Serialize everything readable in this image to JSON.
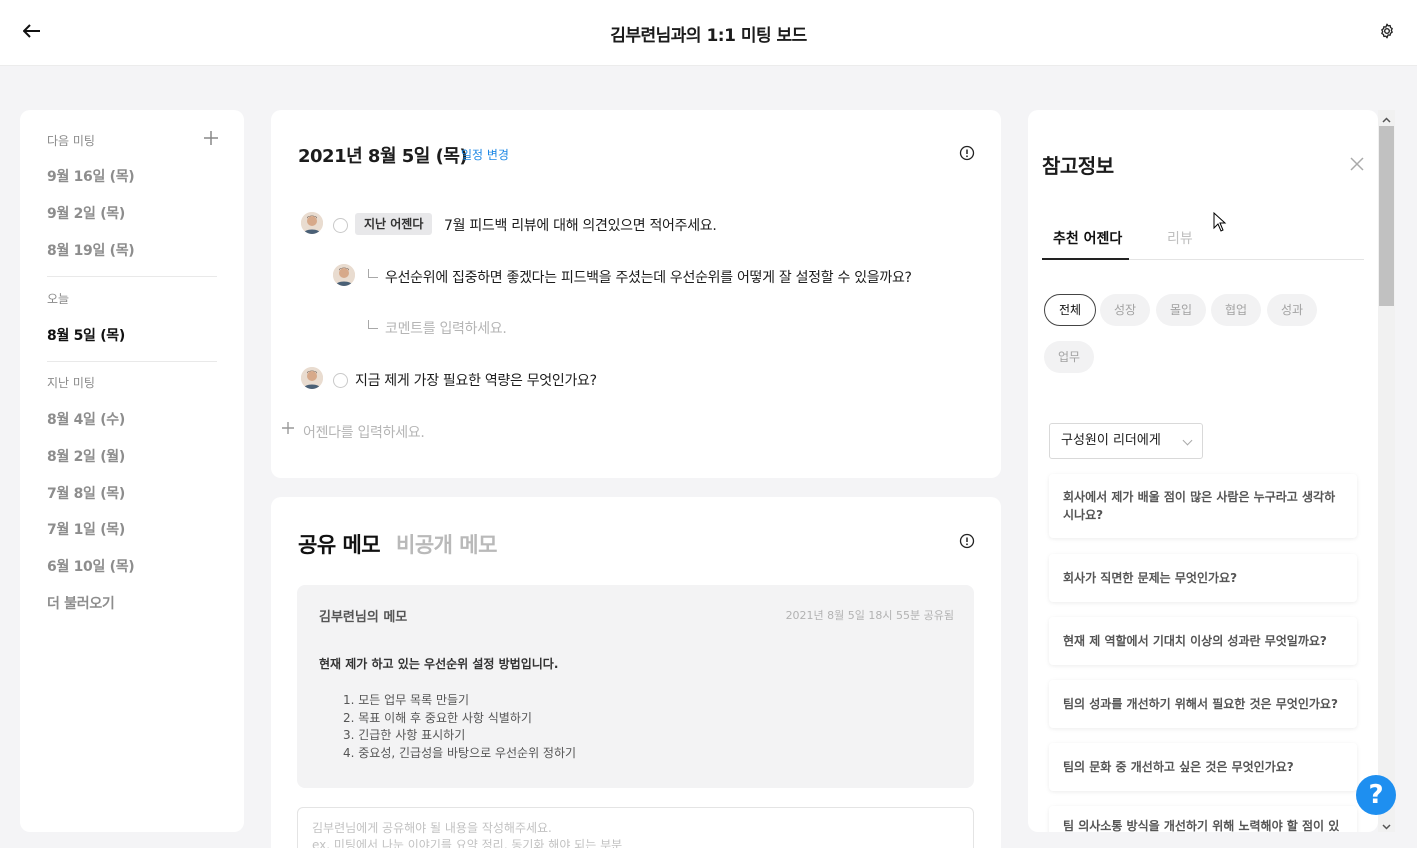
{
  "header": {
    "title": "김부련님과의 1:1 미팅 보드"
  },
  "sidebar": {
    "next_label": "다음 미팅",
    "next_items": [
      "9월 16일 (목)",
      "9월 2일 (목)",
      "8월 19일 (목)"
    ],
    "today_label": "오늘",
    "today_item": "8월 5일 (목)",
    "past_label": "지난 미팅",
    "past_items": [
      "8월 4일 (수)",
      "8월 2일 (월)",
      "7월 8일 (목)",
      "7월 1일 (목)",
      "6월 10일 (목)"
    ],
    "load_more": "더 불러오기"
  },
  "agenda": {
    "date": "2021년 8월 5일 (목)",
    "change_schedule": "일정 변경",
    "item1_tag": "지난 어젠다",
    "item1_text": "7월 피드백 리뷰에 대해 의견있으면 적어주세요.",
    "reply1_text": "우선순위에 집중하면 좋겠다는 피드백을 주셨는데 우선순위를 어떻게 잘 설정할 수 있을까요?",
    "comment_placeholder": "코멘트를 입력하세요.",
    "item2_text": "지금 제게 가장 필요한 역량은 무엇인가요?",
    "add_placeholder": "어젠다를 입력하세요."
  },
  "memo": {
    "tab_shared": "공유 메모",
    "tab_private": "비공개 메모",
    "author": "김부련님의 메모",
    "timestamp": "2021년 8월 5일 18시 55분 공유됨",
    "heading": "현재 제가 하고 있는 우선순위 설정 방법입니다.",
    "items": [
      "1. 모든 업무 목록 만들기",
      "2. 목표 이해 후 중요한 사항 식별하기",
      "3. 긴급한 사항 표시하기",
      "4. 중요성, 긴급성을 바탕으로 우선순위 정하기"
    ],
    "input_placeholder_1": "김부련님에게 공유해야 될 내용을 작성해주세요.",
    "input_placeholder_2": "ex. 미팅에서 나눈 이야기를 요약 정리, 동기화 해야 되는 부분"
  },
  "reference": {
    "title": "참고정보",
    "tabs": [
      "추천 어젠다",
      "리뷰"
    ],
    "chips": [
      "전체",
      "성장",
      "몰입",
      "협업",
      "성과",
      "업무"
    ],
    "select_value": "구성원이 리더에게",
    "questions": [
      "회사에서 제가 배울 점이 많은 사람은 누구라고 생각하시나요?",
      "회사가 직면한 문제는 무엇인가요?",
      "현재 제 역할에서 기대치 이상의 성과란 무엇일까요?",
      "팀의 성과를 개선하기 위해서 필요한 것은 무엇인가요?",
      "팀의 문화 중 개선하고 싶은 것은 무엇인가요?",
      "팀 의사소통 방식을 개선하기 위해 노력해야 할 점이 있"
    ]
  },
  "help": {
    "label": "?"
  },
  "colors": {
    "accent": "#1e88e5",
    "help": "#1e8ff0"
  }
}
